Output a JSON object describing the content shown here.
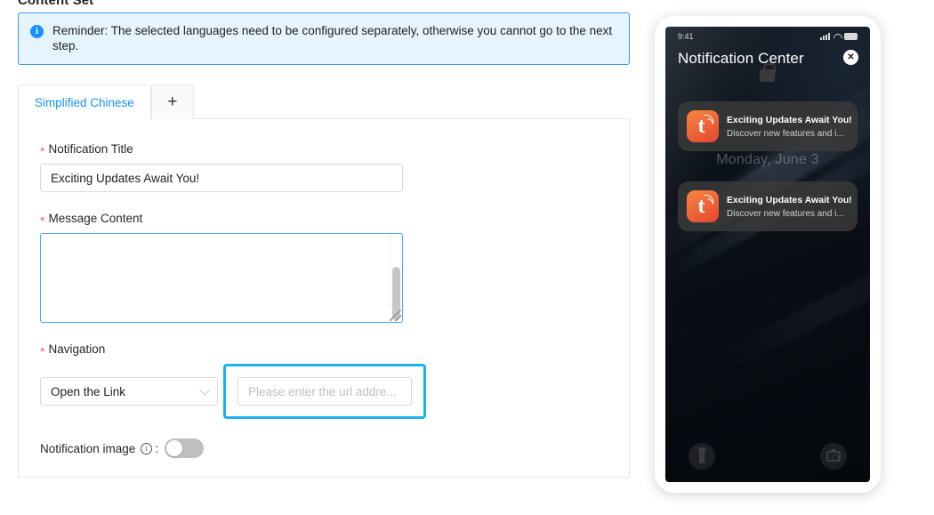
{
  "section": {
    "heading": "Content Set"
  },
  "alert": {
    "icon": "info-circle-icon",
    "message": "Reminder: The selected languages need to be configured separately, otherwise you cannot go to the next step."
  },
  "tabs": {
    "items": [
      {
        "label": "Simplified Chinese",
        "active": true
      }
    ],
    "add_label": "+"
  },
  "form": {
    "required_marker": "*",
    "title_field": {
      "label": "Notification Title",
      "value": "Exciting Updates Await You!",
      "placeholder": ""
    },
    "message_field": {
      "label": "Message Content",
      "value": "",
      "placeholder": ""
    },
    "navigation_field": {
      "label": "Navigation",
      "select_value": "Open the Link",
      "url_value": "",
      "url_placeholder": "Please enter the url addre..."
    },
    "notification_image": {
      "label": "Notification image",
      "colon": ":",
      "info_icon": "info-circle-outline-icon",
      "enabled": false
    }
  },
  "preview": {
    "status_bar": {
      "time": "9:41",
      "signal_icon": "cellular-signal-icon",
      "wifi_icon": "wifi-icon",
      "battery_icon": "battery-icon"
    },
    "title": "Notification Center",
    "close_label": "✕",
    "lock_icon": "lock-icon",
    "date": "Monday, June 3",
    "notifications": [
      {
        "app_icon": "app-logo-icon",
        "title": "Exciting Updates Await You!",
        "subtitle": "Discover new features and i..."
      },
      {
        "app_icon": "app-logo-icon",
        "title": "Exciting Updates Await You!",
        "subtitle": "Discover new features and i..."
      }
    ],
    "bottom_bar": {
      "flashlight_icon": "flashlight-icon",
      "camera_icon": "camera-icon"
    }
  },
  "colors": {
    "accent": "#1890ff",
    "alert_bg": "#e6f4ff",
    "alert_border": "#3c9ae8",
    "highlight": "#1ab2f0",
    "required": "#f5685f"
  }
}
